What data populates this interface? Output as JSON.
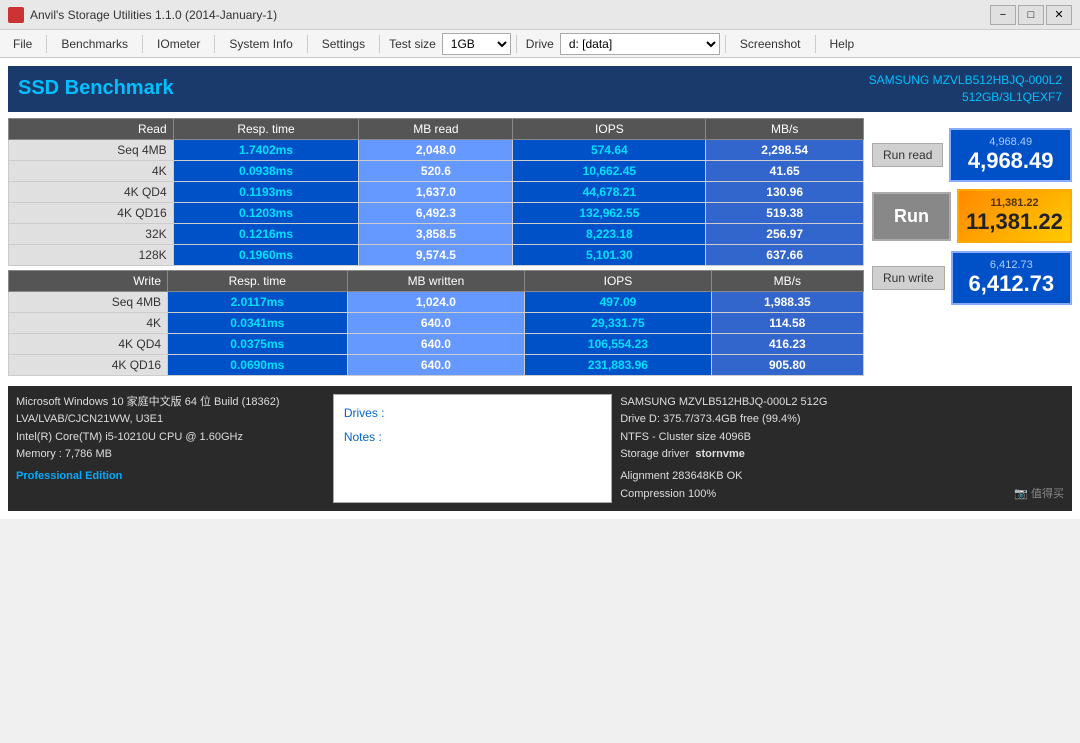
{
  "titleBar": {
    "title": "Anvil's Storage Utilities 1.1.0 (2014-January-1)",
    "minimize": "−",
    "maximize": "□",
    "close": "✕"
  },
  "menuBar": {
    "file": "File",
    "benchmarks": "Benchmarks",
    "iometer": "IOmeter",
    "systemInfo": "System Info",
    "settings": "Settings",
    "testSizeLabel": "Test size",
    "testSizeValue": "1GB",
    "driveLabel": "Drive",
    "driveValue": "d: [data]",
    "screenshot": "Screenshot",
    "help": "Help"
  },
  "header": {
    "title": "SSD Benchmark",
    "driveLine1": "SAMSUNG MZVLB512HBJQ-000L2",
    "driveLine2": "512GB/3L1QEXF7"
  },
  "readTable": {
    "headers": [
      "Read",
      "Resp. time",
      "MB read",
      "IOPS",
      "MB/s"
    ],
    "rows": [
      {
        "label": "Seq 4MB",
        "resp": "1.7402ms",
        "mb": "2,048.0",
        "iops": "574.64",
        "mbs": "2,298.54"
      },
      {
        "label": "4K",
        "resp": "0.0938ms",
        "mb": "520.6",
        "iops": "10,662.45",
        "mbs": "41.65"
      },
      {
        "label": "4K QD4",
        "resp": "0.1193ms",
        "mb": "1,637.0",
        "iops": "44,678.21",
        "mbs": "130.96"
      },
      {
        "label": "4K QD16",
        "resp": "0.1203ms",
        "mb": "6,492.3",
        "iops": "132,962.55",
        "mbs": "519.38"
      },
      {
        "label": "32K",
        "resp": "0.1216ms",
        "mb": "3,858.5",
        "iops": "8,223.18",
        "mbs": "256.97"
      },
      {
        "label": "128K",
        "resp": "0.1960ms",
        "mb": "9,574.5",
        "iops": "5,101.30",
        "mbs": "637.66"
      }
    ]
  },
  "writeTable": {
    "headers": [
      "Write",
      "Resp. time",
      "MB written",
      "IOPS",
      "MB/s"
    ],
    "rows": [
      {
        "label": "Seq 4MB",
        "resp": "2.0117ms",
        "mb": "1,024.0",
        "iops": "497.09",
        "mbs": "1,988.35"
      },
      {
        "label": "4K",
        "resp": "0.0341ms",
        "mb": "640.0",
        "iops": "29,331.75",
        "mbs": "114.58"
      },
      {
        "label": "4K QD4",
        "resp": "0.0375ms",
        "mb": "640.0",
        "iops": "106,554.23",
        "mbs": "416.23"
      },
      {
        "label": "4K QD16",
        "resp": "0.0690ms",
        "mb": "640.0",
        "iops": "231,883.96",
        "mbs": "905.80"
      }
    ]
  },
  "scores": {
    "readSmall": "4,968.49",
    "readBig": "4,968.49",
    "totalSmall": "11,381.22",
    "totalBig": "11,381.22",
    "writeSmall": "6,412.73",
    "writeBig": "6,412.73"
  },
  "buttons": {
    "runRead": "Run read",
    "run": "Run",
    "runWrite": "Run write"
  },
  "footer": {
    "sysinfo": [
      "Microsoft Windows 10 家庭中文版 64 位 Build (18362)",
      "LVA/LVAB/CJCN21WW, U3E1",
      "Intel(R) Core(TM) i5-10210U CPU @ 1.60GHz",
      "Memory : 7,786 MB"
    ],
    "proEdition": "Professional Edition",
    "notesLabel1": "Drives :",
    "notesLabel2": "Notes :",
    "driveInfo": [
      "SAMSUNG MZVLB512HBJQ-000L2 512G",
      "Drive D: 375.7/373.4GB free (99.4%)",
      "NTFS - Cluster size 4096B",
      "Storage driver  stornvme"
    ],
    "driveInfo2": [
      "Alignment 283648KB OK",
      "Compression 100%"
    ],
    "watermark": "值得买"
  }
}
